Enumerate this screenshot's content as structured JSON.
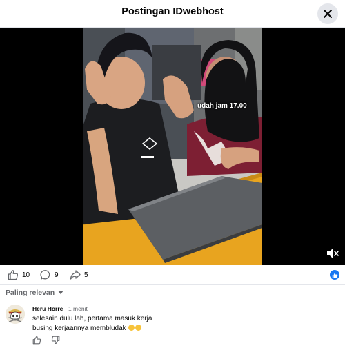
{
  "header": {
    "title": "Postingan IDwebhost"
  },
  "video": {
    "caption": "udah jam 17.00"
  },
  "actions": {
    "likes": "10",
    "comments": "9",
    "shares": "5"
  },
  "sort": {
    "label": "Paling relevan"
  },
  "comment": {
    "author": "Heru Horre",
    "separator": " · ",
    "time": "1 menit",
    "line1": "selesain dulu lah, pertama masuk kerja",
    "line2": "busing kerjaannya membludak"
  },
  "colors": {
    "accent": "#1877f2",
    "secondary_text": "#65676b",
    "divider": "#e4e6eb"
  }
}
